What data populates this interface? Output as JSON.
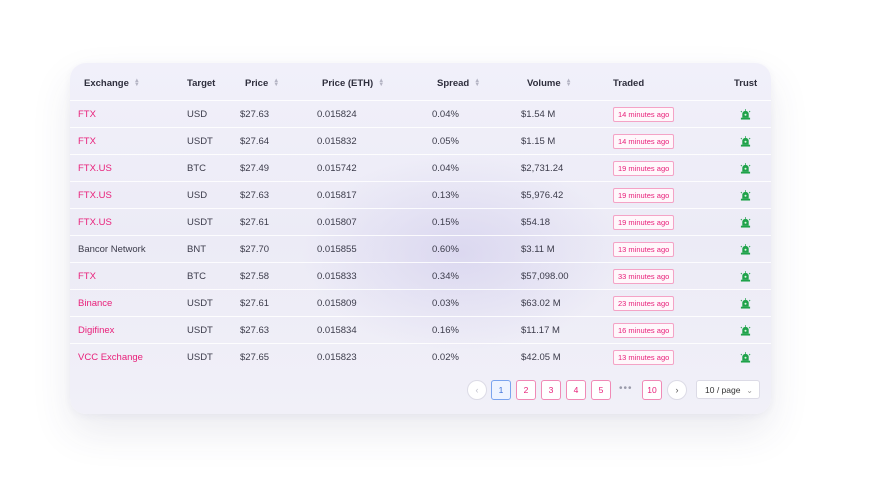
{
  "table": {
    "headers": {
      "exchange": "Exchange",
      "target": "Target",
      "price": "Price",
      "price_eth": "Price (ETH)",
      "spread": "Spread",
      "volume": "Volume",
      "traded": "Traded",
      "trust": "Trust"
    },
    "rows": [
      {
        "exchange": "FTX",
        "target": "USD",
        "price": "$27.63",
        "price_eth": "0.015824",
        "spread": "0.04%",
        "volume": "$1.54 M",
        "traded": "14 minutes ago",
        "exchange_linked": true
      },
      {
        "exchange": "FTX",
        "target": "USDT",
        "price": "$27.64",
        "price_eth": "0.015832",
        "spread": "0.05%",
        "volume": "$1.15 M",
        "traded": "14 minutes ago",
        "exchange_linked": true
      },
      {
        "exchange": "FTX.US",
        "target": "BTC",
        "price": "$27.49",
        "price_eth": "0.015742",
        "spread": "0.04%",
        "volume": "$2,731.24",
        "traded": "19 minutes ago",
        "exchange_linked": true
      },
      {
        "exchange": "FTX.US",
        "target": "USD",
        "price": "$27.63",
        "price_eth": "0.015817",
        "spread": "0.13%",
        "volume": "$5,976.42",
        "traded": "19 minutes ago",
        "exchange_linked": true
      },
      {
        "exchange": "FTX.US",
        "target": "USDT",
        "price": "$27.61",
        "price_eth": "0.015807",
        "spread": "0.15%",
        "volume": "$54.18",
        "traded": "19 minutes ago",
        "exchange_linked": true
      },
      {
        "exchange": "Bancor Network",
        "target": "BNT",
        "price": "$27.70",
        "price_eth": "0.015855",
        "spread": "0.60%",
        "volume": "$3.11 M",
        "traded": "13 minutes ago",
        "exchange_linked": false
      },
      {
        "exchange": "FTX",
        "target": "BTC",
        "price": "$27.58",
        "price_eth": "0.015833",
        "spread": "0.34%",
        "volume": "$57,098.00",
        "traded": "33 minutes ago",
        "exchange_linked": true
      },
      {
        "exchange": "Binance",
        "target": "USDT",
        "price": "$27.61",
        "price_eth": "0.015809",
        "spread": "0.03%",
        "volume": "$63.02 M",
        "traded": "23 minutes ago",
        "exchange_linked": true
      },
      {
        "exchange": "Digifinex",
        "target": "USDT",
        "price": "$27.63",
        "price_eth": "0.015834",
        "spread": "0.16%",
        "volume": "$11.17 M",
        "traded": "16 minutes ago",
        "exchange_linked": true
      },
      {
        "exchange": "VCC Exchange",
        "target": "USDT",
        "price": "$27.65",
        "price_eth": "0.015823",
        "spread": "0.02%",
        "volume": "$42.05 M",
        "traded": "13 minutes ago",
        "exchange_linked": true
      }
    ],
    "trust_icon": "green-trust-icon"
  },
  "pagination": {
    "prev_icon": "chevron-left-icon",
    "next_icon": "chevron-right-icon",
    "pages": [
      "1",
      "2",
      "3",
      "4",
      "5"
    ],
    "ellipsis": "•••",
    "last_page": "10",
    "current_page": "1",
    "page_size_label": "10 / page"
  },
  "colors": {
    "accent": "#e8207a",
    "trust_green": "#1fa24a",
    "active_page": "#3a6fd8"
  }
}
